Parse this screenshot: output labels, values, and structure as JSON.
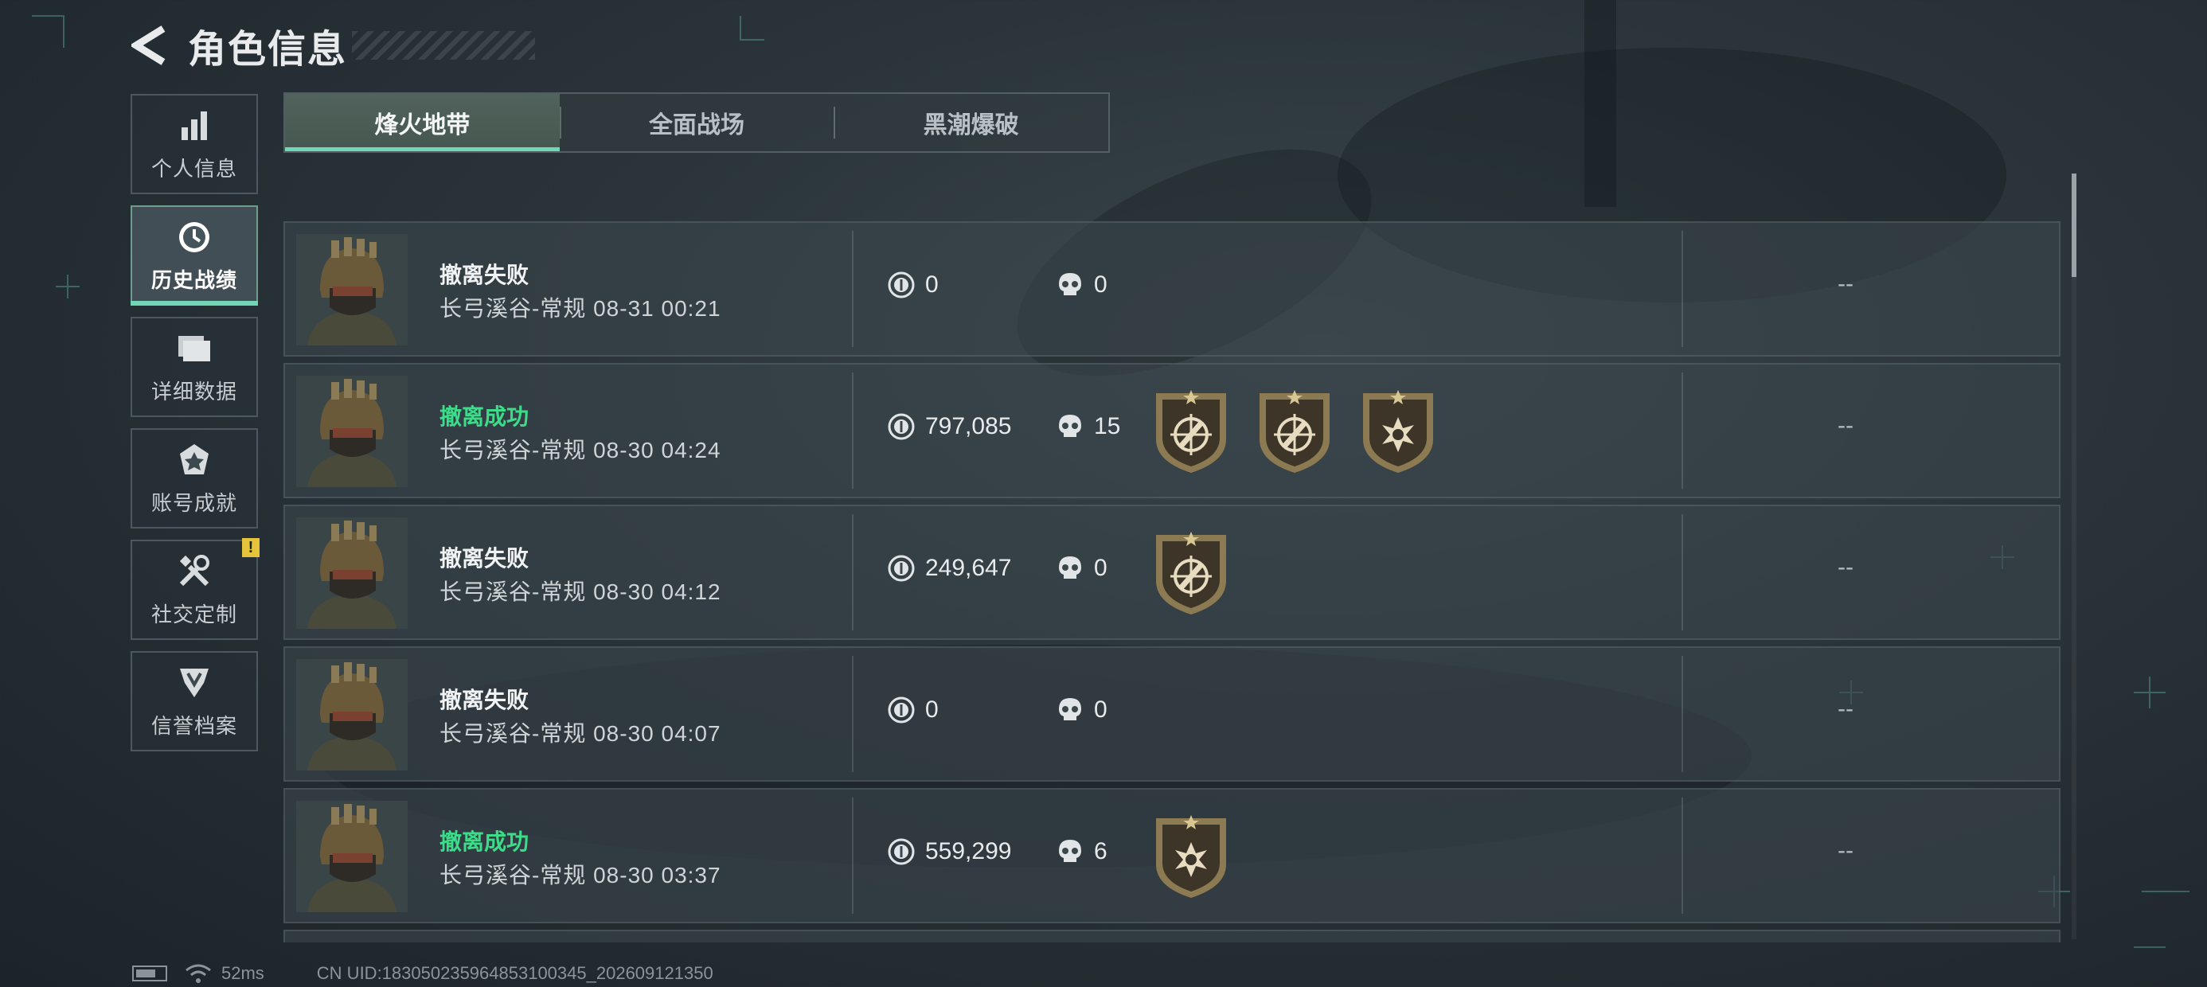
{
  "header": {
    "title": "角色信息"
  },
  "sidebar": {
    "items": [
      {
        "label": "个人信息",
        "icon": "bar-chart-icon",
        "active": false
      },
      {
        "label": "历史战绩",
        "icon": "clock-icon",
        "active": true
      },
      {
        "label": "详细数据",
        "icon": "folder-icon",
        "active": false
      },
      {
        "label": "账号成就",
        "icon": "medal-icon",
        "active": false
      },
      {
        "label": "社交定制",
        "icon": "wrench-icon",
        "active": false,
        "badge": "!"
      },
      {
        "label": "信誉档案",
        "icon": "shield-rank-icon",
        "active": false
      }
    ]
  },
  "tabs": [
    {
      "label": "烽火地带",
      "active": true
    },
    {
      "label": "全面战场",
      "active": false
    },
    {
      "label": "黑潮爆破",
      "active": false
    }
  ],
  "records": [
    {
      "status": "撤离失败",
      "success": false,
      "map_time": "长弓溪谷-常规 08-31 00:21",
      "value": "0",
      "kills": "0",
      "medals": [],
      "extra": "--"
    },
    {
      "status": "撤离成功",
      "success": true,
      "map_time": "长弓溪谷-常规 08-30 04:24",
      "value": "797,085",
      "kills": "15",
      "medals": [
        "crosshair-medal-icon",
        "crosshair-medal-icon",
        "skull-burst-medal-icon"
      ],
      "extra": "--"
    },
    {
      "status": "撤离失败",
      "success": false,
      "map_time": "长弓溪谷-常规 08-30 04:12",
      "value": "249,647",
      "kills": "0",
      "medals": [
        "crosshair-medal-icon"
      ],
      "extra": "--"
    },
    {
      "status": "撤离失败",
      "success": false,
      "map_time": "长弓溪谷-常规 08-30 04:07",
      "value": "0",
      "kills": "0",
      "medals": [],
      "extra": "--"
    },
    {
      "status": "撤离成功",
      "success": true,
      "map_time": "长弓溪谷-常规 08-30 03:37",
      "value": "559,299",
      "kills": "6",
      "medals": [
        "skull-burst-medal-icon"
      ],
      "extra": "--"
    }
  ],
  "footer": {
    "ping": "52ms",
    "uid": "CN UID:183050235964853100345_202609121350"
  },
  "colors": {
    "accent": "#6fd7b4",
    "success": "#3ddc8a",
    "badge": "#e5c33a"
  }
}
